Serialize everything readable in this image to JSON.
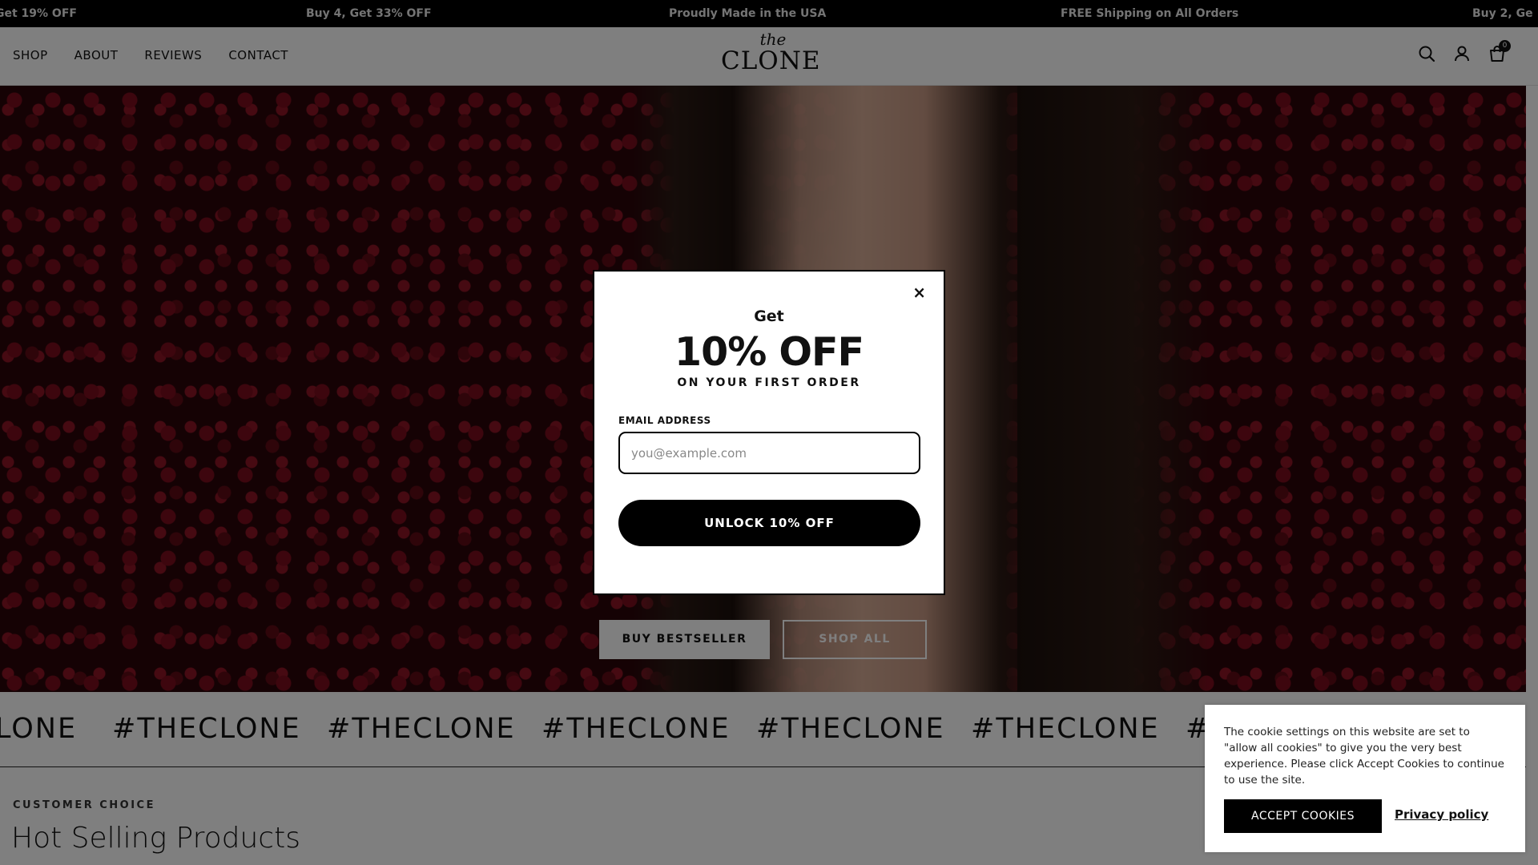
{
  "announcement": {
    "items": [
      "Get 19% OFF",
      "Buy 4, Get 33% OFF",
      "Proudly Made in the USA",
      "FREE Shipping on All Orders",
      "Buy 2, Ge"
    ]
  },
  "header": {
    "nav": [
      "SHOP",
      "ABOUT",
      "REVIEWS",
      "CONTACT"
    ],
    "logo": {
      "top": "the",
      "main": "CLONE"
    },
    "icons": [
      "search-icon",
      "account-icon",
      "cart-icon"
    ],
    "cart_count": "0"
  },
  "hero": {
    "buy_button": "BUY BESTSELLER",
    "shop_button": "SHOP ALL"
  },
  "marquee": {
    "text": "#THECLONE",
    "items": [
      "LONE",
      "#THECLONE",
      "#THECLONE",
      "#THECLONE",
      "#THECLONE",
      "#THECLONE",
      "#T"
    ]
  },
  "section": {
    "eyebrow": "CUSTOMER CHOICE",
    "title": "Hot Selling Products"
  },
  "modal": {
    "get": "Get",
    "offer": "10% OFF",
    "sub": "ON YOUR FIRST ORDER",
    "email_label": "EMAIL ADDRESS",
    "email_placeholder": "you@example.com",
    "email_value": "",
    "submit": "UNLOCK 10% OFF",
    "close": "×"
  },
  "cookie": {
    "text": "The cookie settings on this website are set to \"allow all cookies\" to give you the very best experience. Please click Accept Cookies to continue to use the site.",
    "accept": "ACCEPT COOKIES",
    "policy": "Privacy policy"
  },
  "colors": {
    "accent": "#000000",
    "overlay": "rgba(0,0,0,0.5)"
  }
}
